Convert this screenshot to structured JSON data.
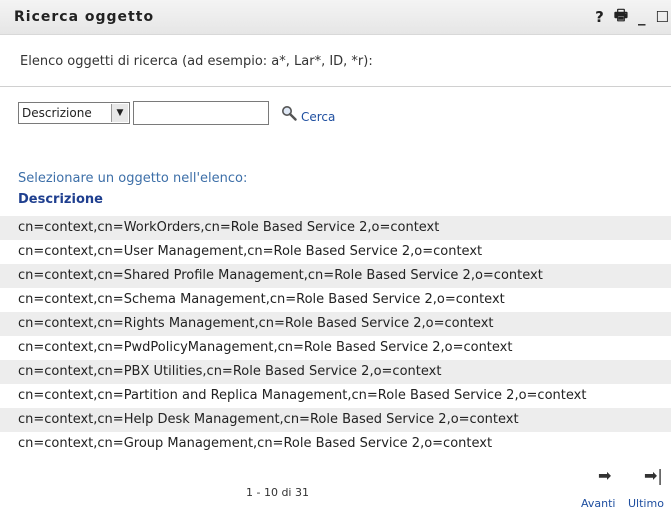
{
  "window": {
    "title": "Ricerca oggetto",
    "icons": {
      "help": "?",
      "print": "🖶",
      "minimize": "_",
      "maximize": "☐"
    }
  },
  "instructions": "Elenco oggetti di ricerca (ad esempio: a*, Lar*, ID, *r):",
  "search": {
    "attribute_select": "Descrizione",
    "input_value": "",
    "button_label": "Cerca"
  },
  "results": {
    "prompt": "Selezionare un oggetto nell'elenco:",
    "column_header": "Descrizione",
    "rows": [
      "cn=context,cn=WorkOrders,cn=Role Based Service 2,o=context",
      "cn=context,cn=User Management,cn=Role Based Service 2,o=context",
      "cn=context,cn=Shared Profile Management,cn=Role Based Service 2,o=context",
      "cn=context,cn=Schema Management,cn=Role Based Service 2,o=context",
      "cn=context,cn=Rights Management,cn=Role Based Service 2,o=context",
      "cn=context,cn=PwdPolicyManagement,cn=Role Based Service 2,o=context",
      "cn=context,cn=PBX Utilities,cn=Role Based Service 2,o=context",
      "cn=context,cn=Partition and Replica Management,cn=Role Based Service 2,o=context",
      "cn=context,cn=Help Desk Management,cn=Role Based Service 2,o=context",
      "cn=context,cn=Group Management,cn=Role Based Service 2,o=context"
    ]
  },
  "pagination": {
    "info": "1 - 10 di 31",
    "next_label": "Avanti",
    "last_label": "Ultimo",
    "next_icon": "➡",
    "last_icon": "➡|"
  },
  "colors": {
    "link": "#1f4fa0",
    "header_text": "#1f3f8f",
    "prompt_text": "#3d6fa8",
    "alt_row": "#ededed"
  }
}
